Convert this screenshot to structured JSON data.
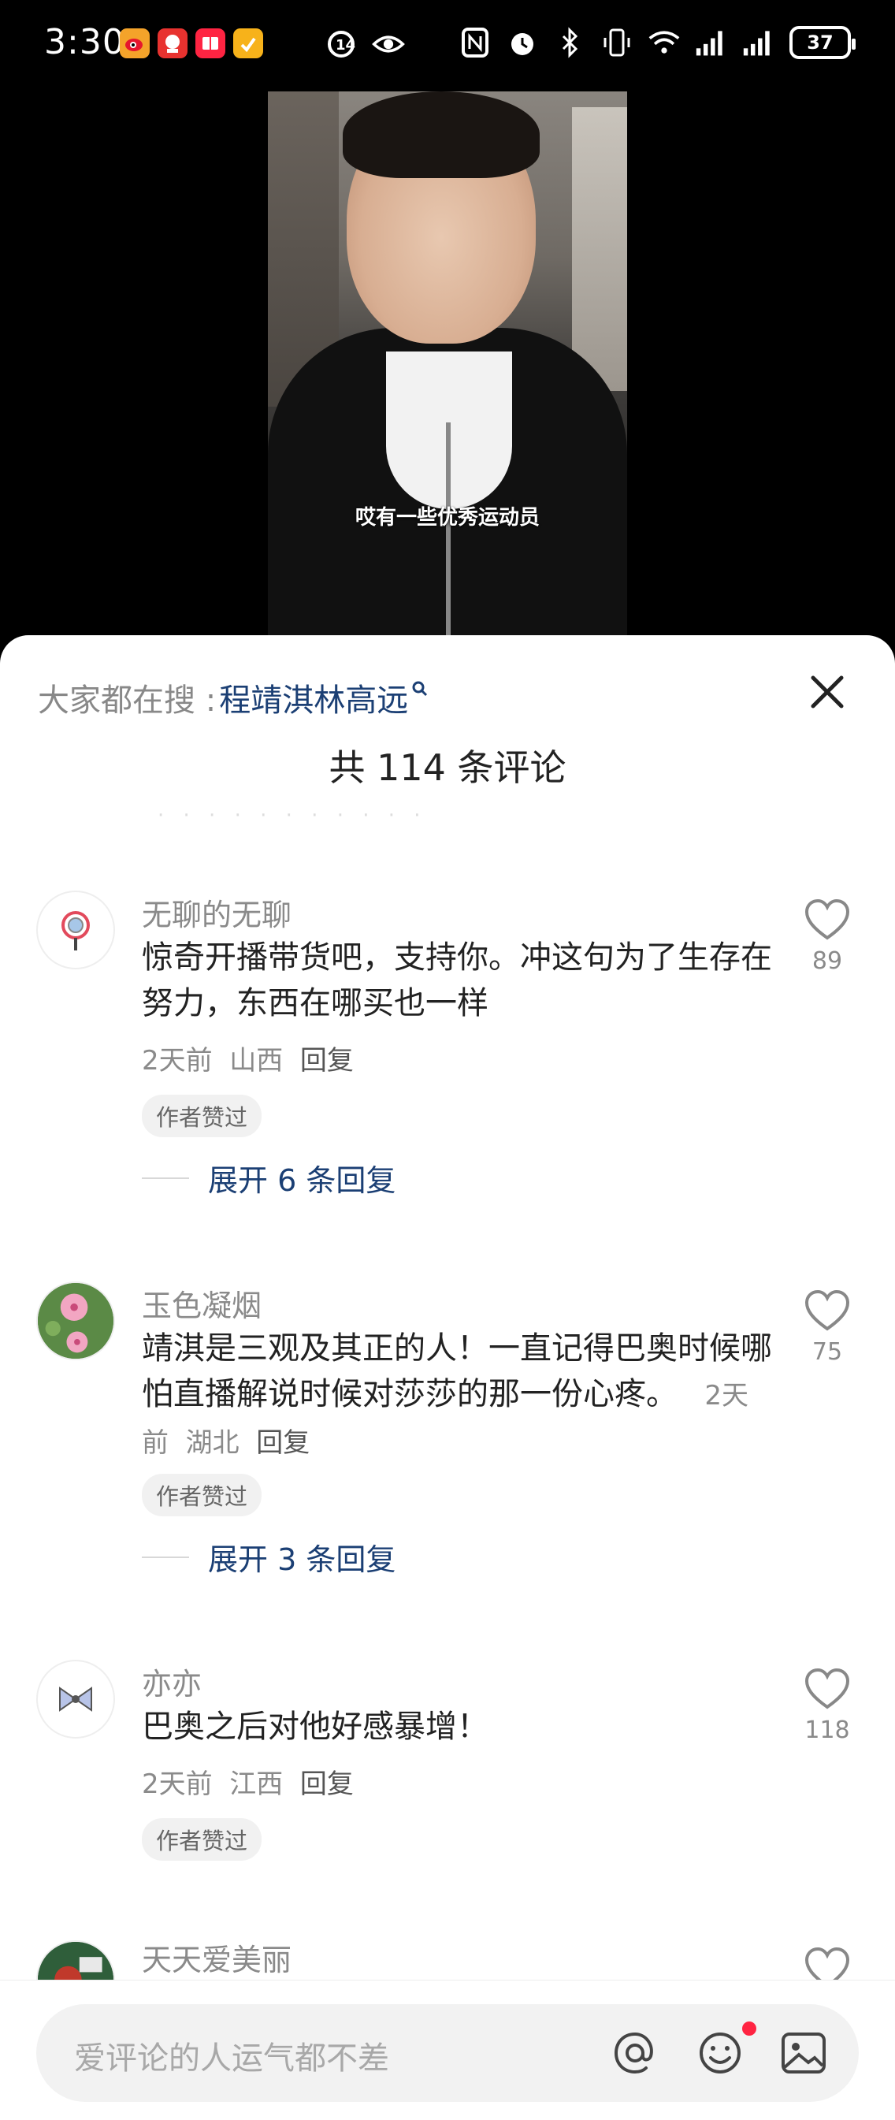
{
  "status_bar": {
    "time": "3:30",
    "battery": "37"
  },
  "video": {
    "subtitle": "哎有一些优秀运动员"
  },
  "sheet": {
    "search_prefix": "大家都在搜 :",
    "search_keyword": "程靖淇林高远",
    "title": "共 114 条评论"
  },
  "comments": [
    {
      "name": "无聊的无聊",
      "text": "惊奇开播带货吧，支持你。冲这句为了生存在努力，东西在哪买也一样",
      "time": "2天前",
      "location": "山西",
      "reply_label": "回复",
      "badge": "作者赞过",
      "expand": "展开 6 条回复",
      "likes": "89"
    },
    {
      "name": "玉色凝烟",
      "text": "靖淇是三观及其正的人！一直记得巴奥时候哪怕直播解说时候对莎莎的那一份心疼。",
      "time": "2天前",
      "location": "湖北",
      "reply_label": "回复",
      "badge": "作者赞过",
      "expand": "展开 3 条回复",
      "likes": "75"
    },
    {
      "name": "亦亦",
      "text": "巴奥之后对他好感暴增！",
      "time": "2天前",
      "location": "江西",
      "reply_label": "回复",
      "badge": "作者赞过",
      "likes": "118"
    },
    {
      "name": "天天爱美丽"
    }
  ],
  "input": {
    "placeholder": "爱评论的人运气都不差"
  },
  "colors": {
    "accent_blue": "#1b3f74",
    "notification_red": "#ff2442",
    "meta_gray": "#8a8a8a"
  },
  "icons": [
    "weibo-icon",
    "app-icon",
    "book-icon",
    "task-icon",
    "location-icon",
    "eye-icon",
    "nfc-icon",
    "alarm-icon",
    "bluetooth-icon",
    "vibrate-icon",
    "wifi-icon",
    "signal-icon",
    "close-icon",
    "heart-icon",
    "at-icon",
    "emoji-icon",
    "image-icon"
  ]
}
